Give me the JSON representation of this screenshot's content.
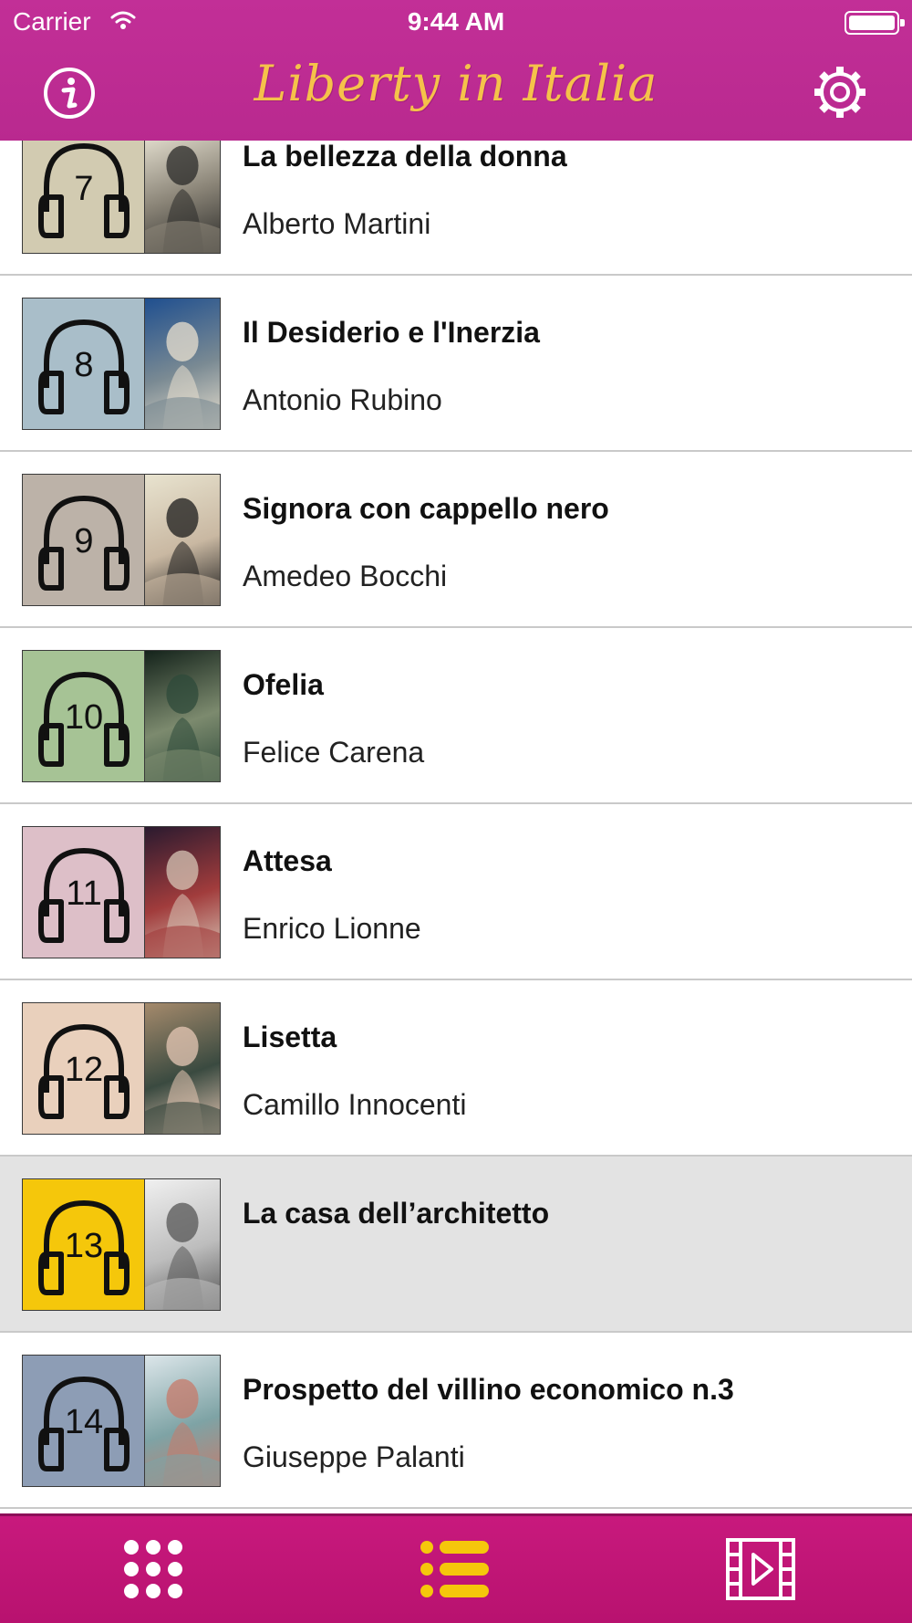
{
  "status_bar": {
    "carrier": "Carrier",
    "time": "9:44 AM"
  },
  "header": {
    "title": "Liberty in Italia",
    "info_icon": "info-icon",
    "settings_icon": "gear-icon"
  },
  "list": {
    "items": [
      {
        "number": "7",
        "title": "La bellezza della donna",
        "artist": "Alberto Martini",
        "tile_color": "#d2cbb1",
        "art": [
          "#f3eede",
          "#2a2a28",
          "#8a8477"
        ]
      },
      {
        "number": "8",
        "title": "Il Desiderio e l'Inerzia",
        "artist": "Antonio Rubino",
        "tile_color": "#a9bec9",
        "art": [
          "#1f4f8f",
          "#e9e0cf",
          "#7a8a93"
        ]
      },
      {
        "number": "9",
        "title": "Signora con cappello nero",
        "artist": "Amedeo Bocchi",
        "tile_color": "#bcb2a8",
        "art": [
          "#e8e3cf",
          "#1b1b1b",
          "#c9b8a2"
        ]
      },
      {
        "number": "10",
        "title": "Ofelia",
        "artist": "Felice Carena",
        "tile_color": "#a6c395",
        "art": [
          "#14231b",
          "#2e4a3a",
          "#7c8a6e"
        ]
      },
      {
        "number": "11",
        "title": "Attesa",
        "artist": "Enrico Lionne",
        "tile_color": "#ddbfc8",
        "art": [
          "#2a1a2f",
          "#d7c5b6",
          "#a13c3c"
        ]
      },
      {
        "number": "12",
        "title": "Lisetta",
        "artist": "Camillo Innocenti",
        "tile_color": "#e9d0bc",
        "art": [
          "#a58a6c",
          "#e7c8b5",
          "#3a4a40"
        ]
      },
      {
        "number": "13",
        "title": "La casa dell’architetto",
        "artist": "",
        "tile_color": "#f5c70b",
        "art": [
          "#f0f0f0",
          "#555555",
          "#bdbdbd"
        ],
        "selected": true
      },
      {
        "number": "14",
        "title": "Prospetto del villino economico n.3",
        "artist": "Giuseppe Palanti",
        "tile_color": "#8d9db5",
        "art": [
          "#dce6ea",
          "#c77a6a",
          "#7ea3a5"
        ]
      }
    ]
  },
  "tabbar": {
    "tabs": [
      {
        "icon": "grid-icon",
        "color": "#ffffff"
      },
      {
        "icon": "list-icon",
        "color": "#f5c70b"
      },
      {
        "icon": "video-icon",
        "color": "#ffffff"
      }
    ]
  }
}
